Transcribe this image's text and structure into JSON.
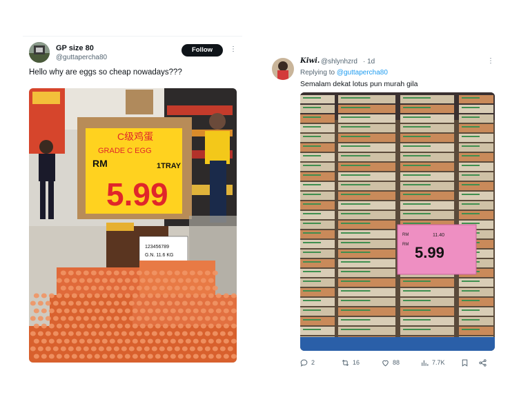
{
  "left_tweet": {
    "display_name": "GP size 80",
    "handle": "@guttapercha80",
    "follow_label": "Follow",
    "text": "Hello why are eggs so cheap nowadays???",
    "photo": {
      "sign_chinese": "C级鸡蛋",
      "sign_grade": "GRADE C EGG",
      "sign_currency": "RM",
      "sign_price": "5.99",
      "sign_unit": "1TRAY",
      "shelf_tag_line1": "123456789",
      "shelf_tag_line2": "G.N.    11.6 KG"
    }
  },
  "right_tweet": {
    "display_name": "Kiwi.",
    "handle": "@shlynhzrd",
    "time": "· 1d",
    "replying_label": "Replying to",
    "replying_handle": "@guttapercha80",
    "text": "Semalam dekat lotus pun murah gila",
    "photo": {
      "tag_rm_top": "RM",
      "tag_old_price": "11.40",
      "tag_rm": "RM",
      "tag_price": "5.99"
    },
    "actions": {
      "replies": "2",
      "retweets": "16",
      "likes": "88",
      "views": "7.7K"
    }
  },
  "colors": {
    "follow_bg": "#0f1419",
    "link": "#1d9bf0",
    "secondary_text": "#536471",
    "sign_yellow": "#ffd21f",
    "sign_red": "#e0262a",
    "tag_pink": "#ee8fc2"
  },
  "icons": [
    "more-icon",
    "reply-icon",
    "retweet-icon",
    "like-icon",
    "views-icon",
    "bookmark-icon",
    "share-icon"
  ]
}
